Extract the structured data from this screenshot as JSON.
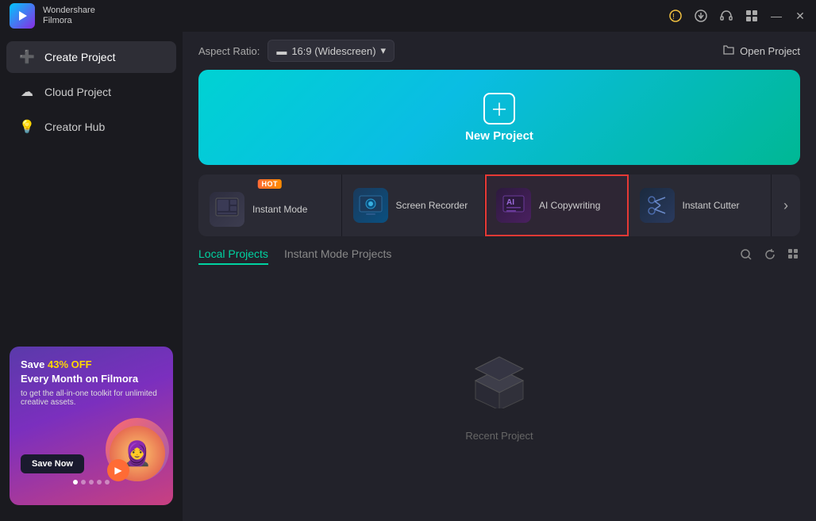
{
  "titleBar": {
    "brand": "Wondershare",
    "product": "Filmora",
    "icons": [
      "notification-icon",
      "download-icon",
      "headset-icon",
      "grid-icon"
    ],
    "minimize": "—",
    "close": "✕"
  },
  "sidebar": {
    "items": [
      {
        "id": "create-project",
        "label": "Create Project",
        "icon": "➕",
        "active": true
      },
      {
        "id": "cloud-project",
        "label": "Cloud Project",
        "icon": "☁",
        "active": false
      },
      {
        "id": "creator-hub",
        "label": "Creator Hub",
        "icon": "💡",
        "active": false
      }
    ],
    "ad": {
      "headline1": "Save ",
      "highlight": "43% OFF",
      "headline2": "Every Month on Filmora",
      "sub": "to get the all-in-one toolkit for unlimited creative assets.",
      "buttonLabel": "Save Now"
    }
  },
  "topBar": {
    "aspectLabel": "Aspect Ratio:",
    "aspectValue": "16:9 (Widescreen)",
    "openProjectLabel": "Open Project"
  },
  "newProject": {
    "label": "New Project"
  },
  "featureCards": [
    {
      "id": "instant-mode",
      "label": "Instant Mode",
      "badge": "HOT",
      "icon": "🎬"
    },
    {
      "id": "screen-recorder",
      "label": "Screen Recorder",
      "badge": null,
      "icon": "🖥"
    },
    {
      "id": "ai-copywriting",
      "label": "AI Copywriting",
      "badge": null,
      "icon": "🤖",
      "selected": true
    },
    {
      "id": "instant-cutter",
      "label": "Instant Cutter",
      "badge": null,
      "icon": "✂"
    }
  ],
  "projectsTabs": {
    "tabs": [
      {
        "id": "local",
        "label": "Local Projects",
        "active": true
      },
      {
        "id": "instant-mode",
        "label": "Instant Mode Projects",
        "active": false
      }
    ]
  },
  "emptyState": {
    "label": "Recent Project"
  }
}
